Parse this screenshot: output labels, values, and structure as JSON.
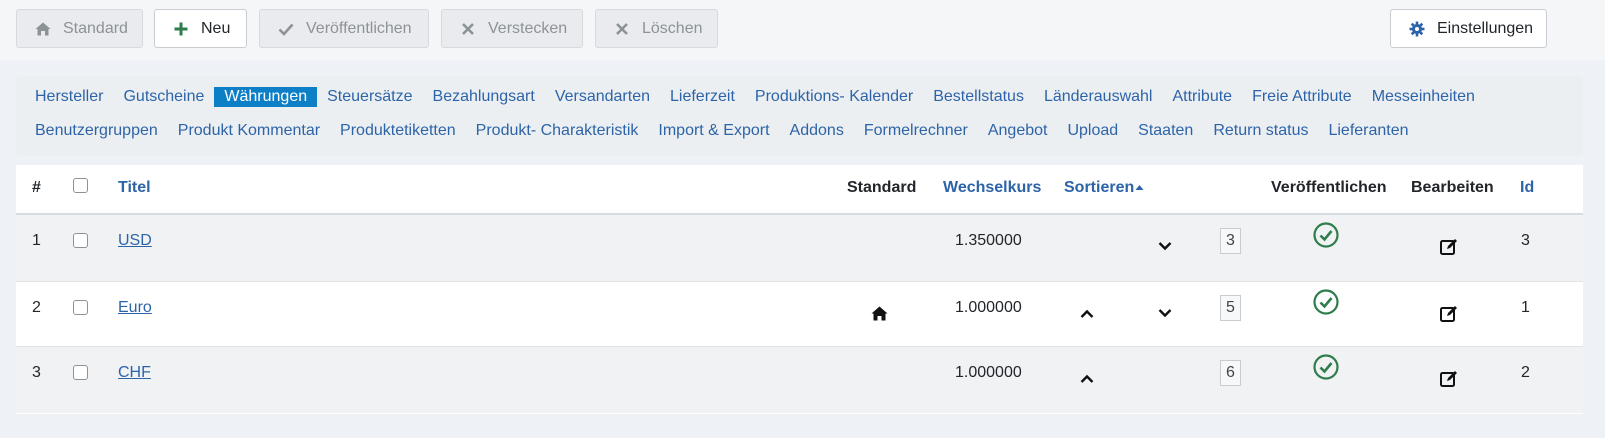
{
  "toolbar": {
    "standard": "Standard",
    "new": "Neu",
    "publish": "Veröffentlichen",
    "hide": "Verstecken",
    "delete": "Löschen",
    "settings": "Einstellungen"
  },
  "submenu": {
    "row1": [
      "Hersteller",
      "Gutscheine",
      "Währungen",
      "Steuersätze",
      "Bezahlungsart",
      "Versandarten",
      "Lieferzeit",
      "Produktions- Kalender",
      "Bestellstatus",
      "Länderauswahl",
      "Attribute",
      "Freie Attribute",
      "Messeinheiten"
    ],
    "row2": [
      "Benutzergruppen",
      "Produkt Kommentar",
      "Produktetiketten",
      "Produkt- Charakteristik",
      "Import & Export",
      "Addons",
      "Formelrechner",
      "Angebot",
      "Upload",
      "Staaten",
      "Return status",
      "Lieferanten"
    ],
    "active": "Währungen"
  },
  "table": {
    "headers": {
      "num": "#",
      "title": "Titel",
      "standard": "Standard",
      "rate": "Wechselkurs",
      "sort": "Sortieren",
      "publish": "Veröffentlichen",
      "edit": "Bearbeiten",
      "id": "Id"
    },
    "rows": [
      {
        "num": "1",
        "title": "USD",
        "is_default": false,
        "rate": "1.350000",
        "up": false,
        "down": true,
        "order": "3",
        "published": true,
        "id": "3"
      },
      {
        "num": "2",
        "title": "Euro",
        "is_default": true,
        "rate": "1.000000",
        "up": true,
        "down": true,
        "order": "5",
        "published": true,
        "id": "1"
      },
      {
        "num": "3",
        "title": "CHF",
        "is_default": false,
        "rate": "1.000000",
        "up": true,
        "down": false,
        "order": "6",
        "published": true,
        "id": "2"
      }
    ]
  },
  "colors": {
    "accent": "#0d7fc7",
    "link": "#2d64a8",
    "published": "#2e7d4a"
  },
  "icons": {
    "standard": "home-icon",
    "new": "plus-icon",
    "publish": "check-icon",
    "hide": "times-icon",
    "delete": "times-icon",
    "settings": "gear-icon",
    "default_marker": "home-icon",
    "published_marker": "check-circle-icon",
    "edit": "edit-icon",
    "up": "chevron-up-icon",
    "down": "chevron-down-icon"
  }
}
